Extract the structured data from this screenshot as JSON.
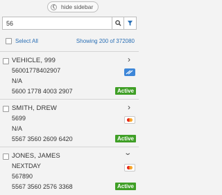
{
  "header": {
    "hide_sidebar_label": "hide sidebar"
  },
  "search": {
    "value": "56",
    "placeholder": ""
  },
  "select_all_label": "Select All",
  "showing_text": "Showing 200 of 372080",
  "colors": {
    "accent": "#2a6fb5",
    "active_badge": "#3f9f26",
    "card_blue": "#3d86d8"
  },
  "items": [
    {
      "name": "VEHICLE, 999",
      "line1": "56001778402907",
      "line2": "N/A",
      "line3": "5600 1778 4003 2907",
      "status": "Active",
      "card_icon": "blue-card-icon",
      "expanded": false
    },
    {
      "name": "SMITH, DREW",
      "line1": "5699",
      "line2": "N/A",
      "line3": "5567 3560 2609 6420",
      "status": "Active",
      "card_icon": "mastercard-icon",
      "expanded": false
    },
    {
      "name": "JONES, JAMES",
      "line1": "NEXTDAY",
      "line2": "567890",
      "line3": "5567 3560 2576 3368",
      "status": "Active",
      "card_icon": "mastercard-icon",
      "expanded": true
    }
  ]
}
